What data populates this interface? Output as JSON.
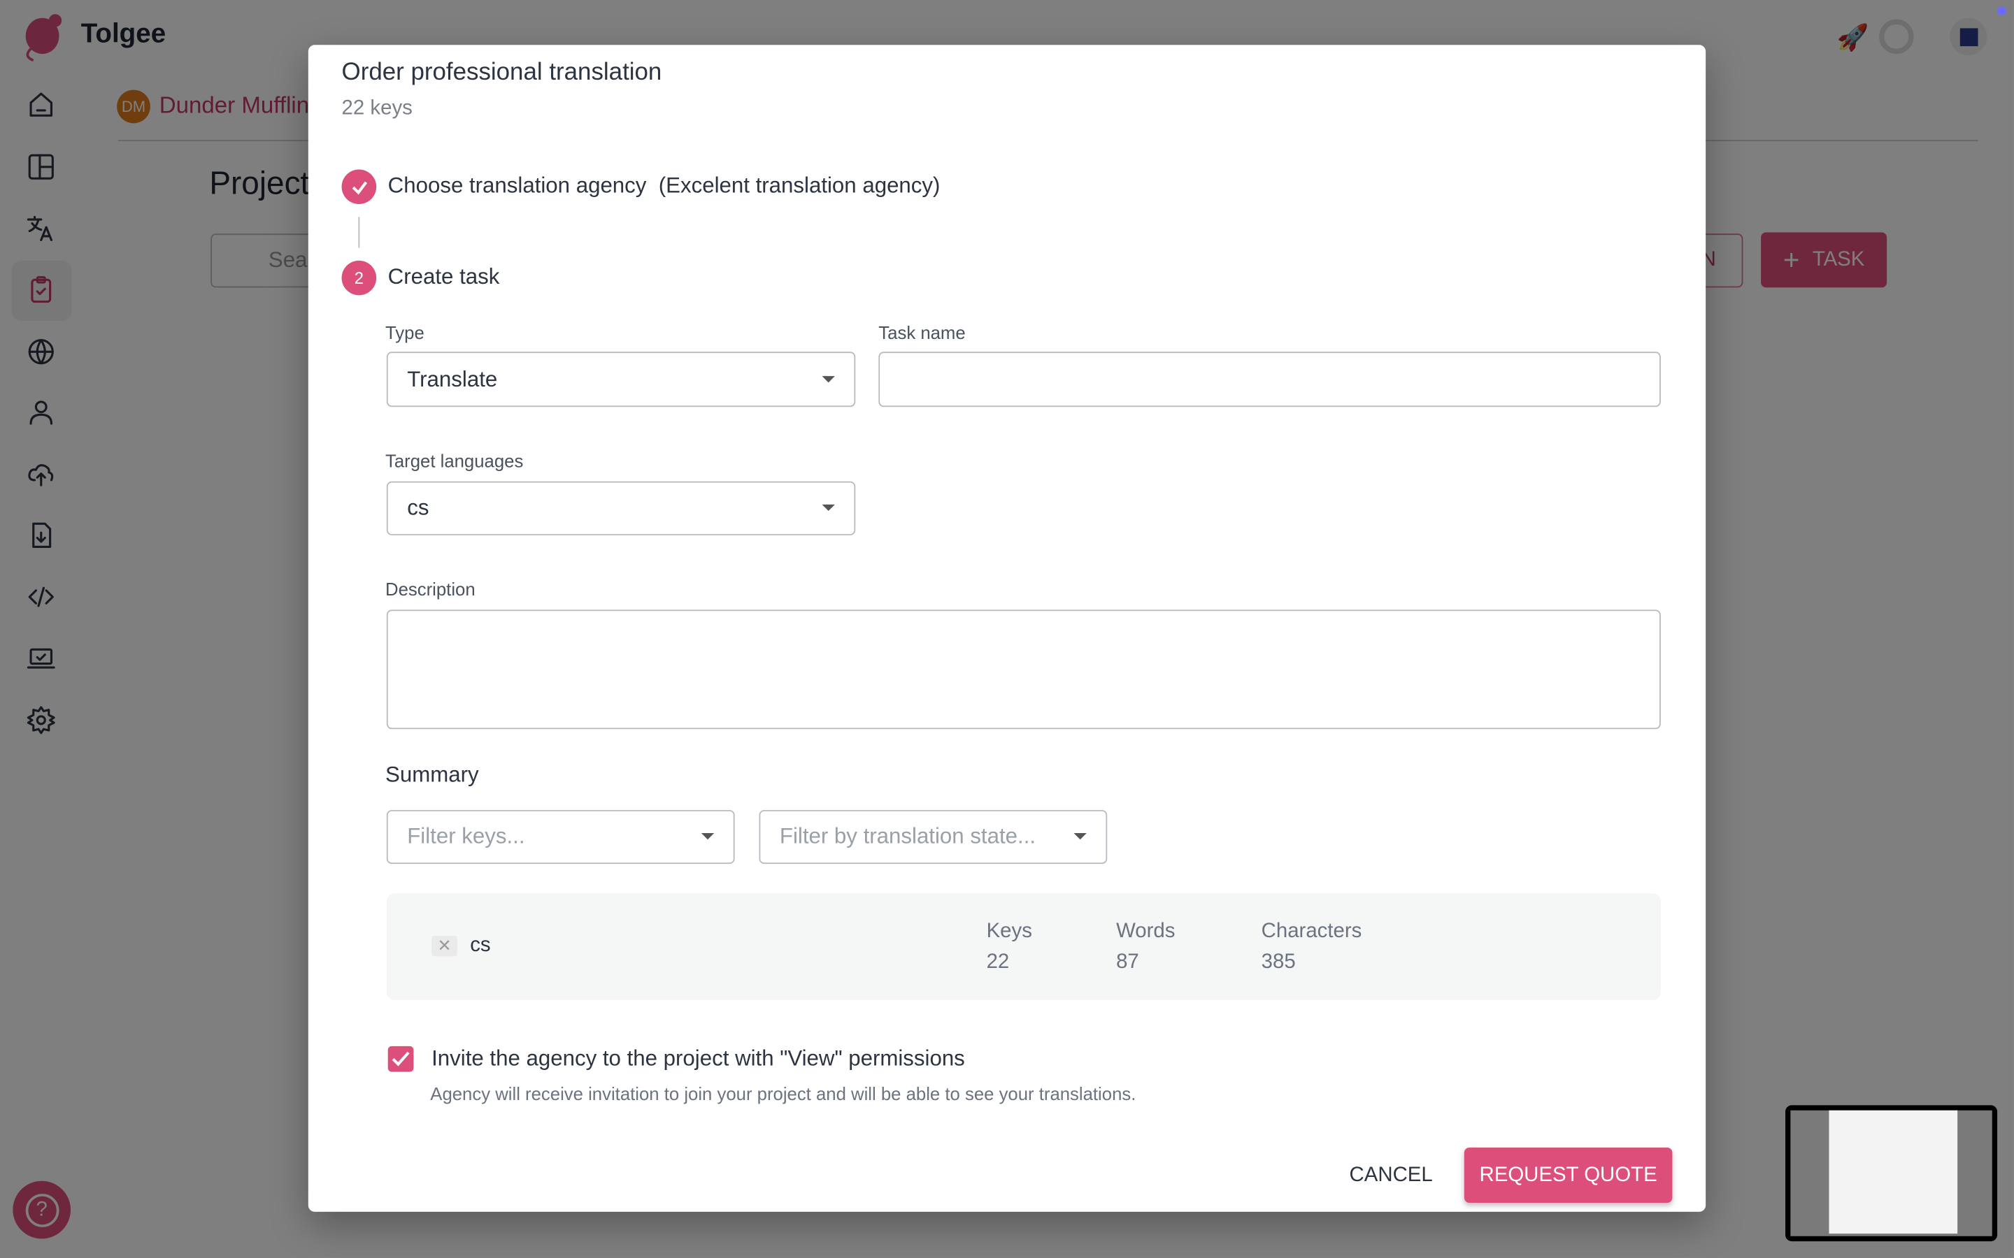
{
  "app": {
    "name": "Tolgee",
    "brand_color": "#dc4f7b"
  },
  "sidebar": {
    "items": [
      {
        "icon": "home-icon"
      },
      {
        "icon": "dashboard-icon"
      },
      {
        "icon": "translate-icon"
      },
      {
        "icon": "tasks-icon",
        "active": true
      },
      {
        "icon": "languages-globe-icon"
      },
      {
        "icon": "members-icon"
      },
      {
        "icon": "import-icon"
      },
      {
        "icon": "export-icon"
      },
      {
        "icon": "developer-code-icon"
      },
      {
        "icon": "integrate-icon"
      },
      {
        "icon": "settings-icon"
      }
    ],
    "help_icon": "help-icon"
  },
  "breadcrumb": {
    "avatar_initials": "DM",
    "org": "Dunder Mufflin"
  },
  "page": {
    "title": "Projects",
    "search_placeholder": "Search",
    "outlined_button_tail": "N",
    "add_task_label": "TASK"
  },
  "modal": {
    "title": "Order professional translation",
    "subtitle": "22 keys",
    "steps": [
      {
        "label": "Choose translation agency",
        "detail": "(Excelent translation agency)",
        "done": true
      },
      {
        "number": "2",
        "label": "Create task"
      }
    ],
    "type_label": "Type",
    "type_value": "Translate",
    "task_name_label": "Task name",
    "task_name_value": "",
    "target_languages_label": "Target languages",
    "target_languages_value": "cs",
    "description_label": "Description",
    "description_value": "",
    "summary_title": "Summary",
    "filter_keys_placeholder": "Filter keys...",
    "filter_state_placeholder": "Filter by translation state...",
    "summary_row": {
      "language": "cs",
      "keys_label": "Keys",
      "keys": "22",
      "words_label": "Words",
      "words": "87",
      "characters_label": "Characters",
      "characters": "385"
    },
    "invite_label": "Invite the agency to the project with \"View\" permissions",
    "invite_checked": true,
    "invite_help": "Agency will receive invitation to join your project and will be able to see your translations.",
    "cancel_label": "CANCEL",
    "submit_label": "REQUEST QUOTE"
  }
}
